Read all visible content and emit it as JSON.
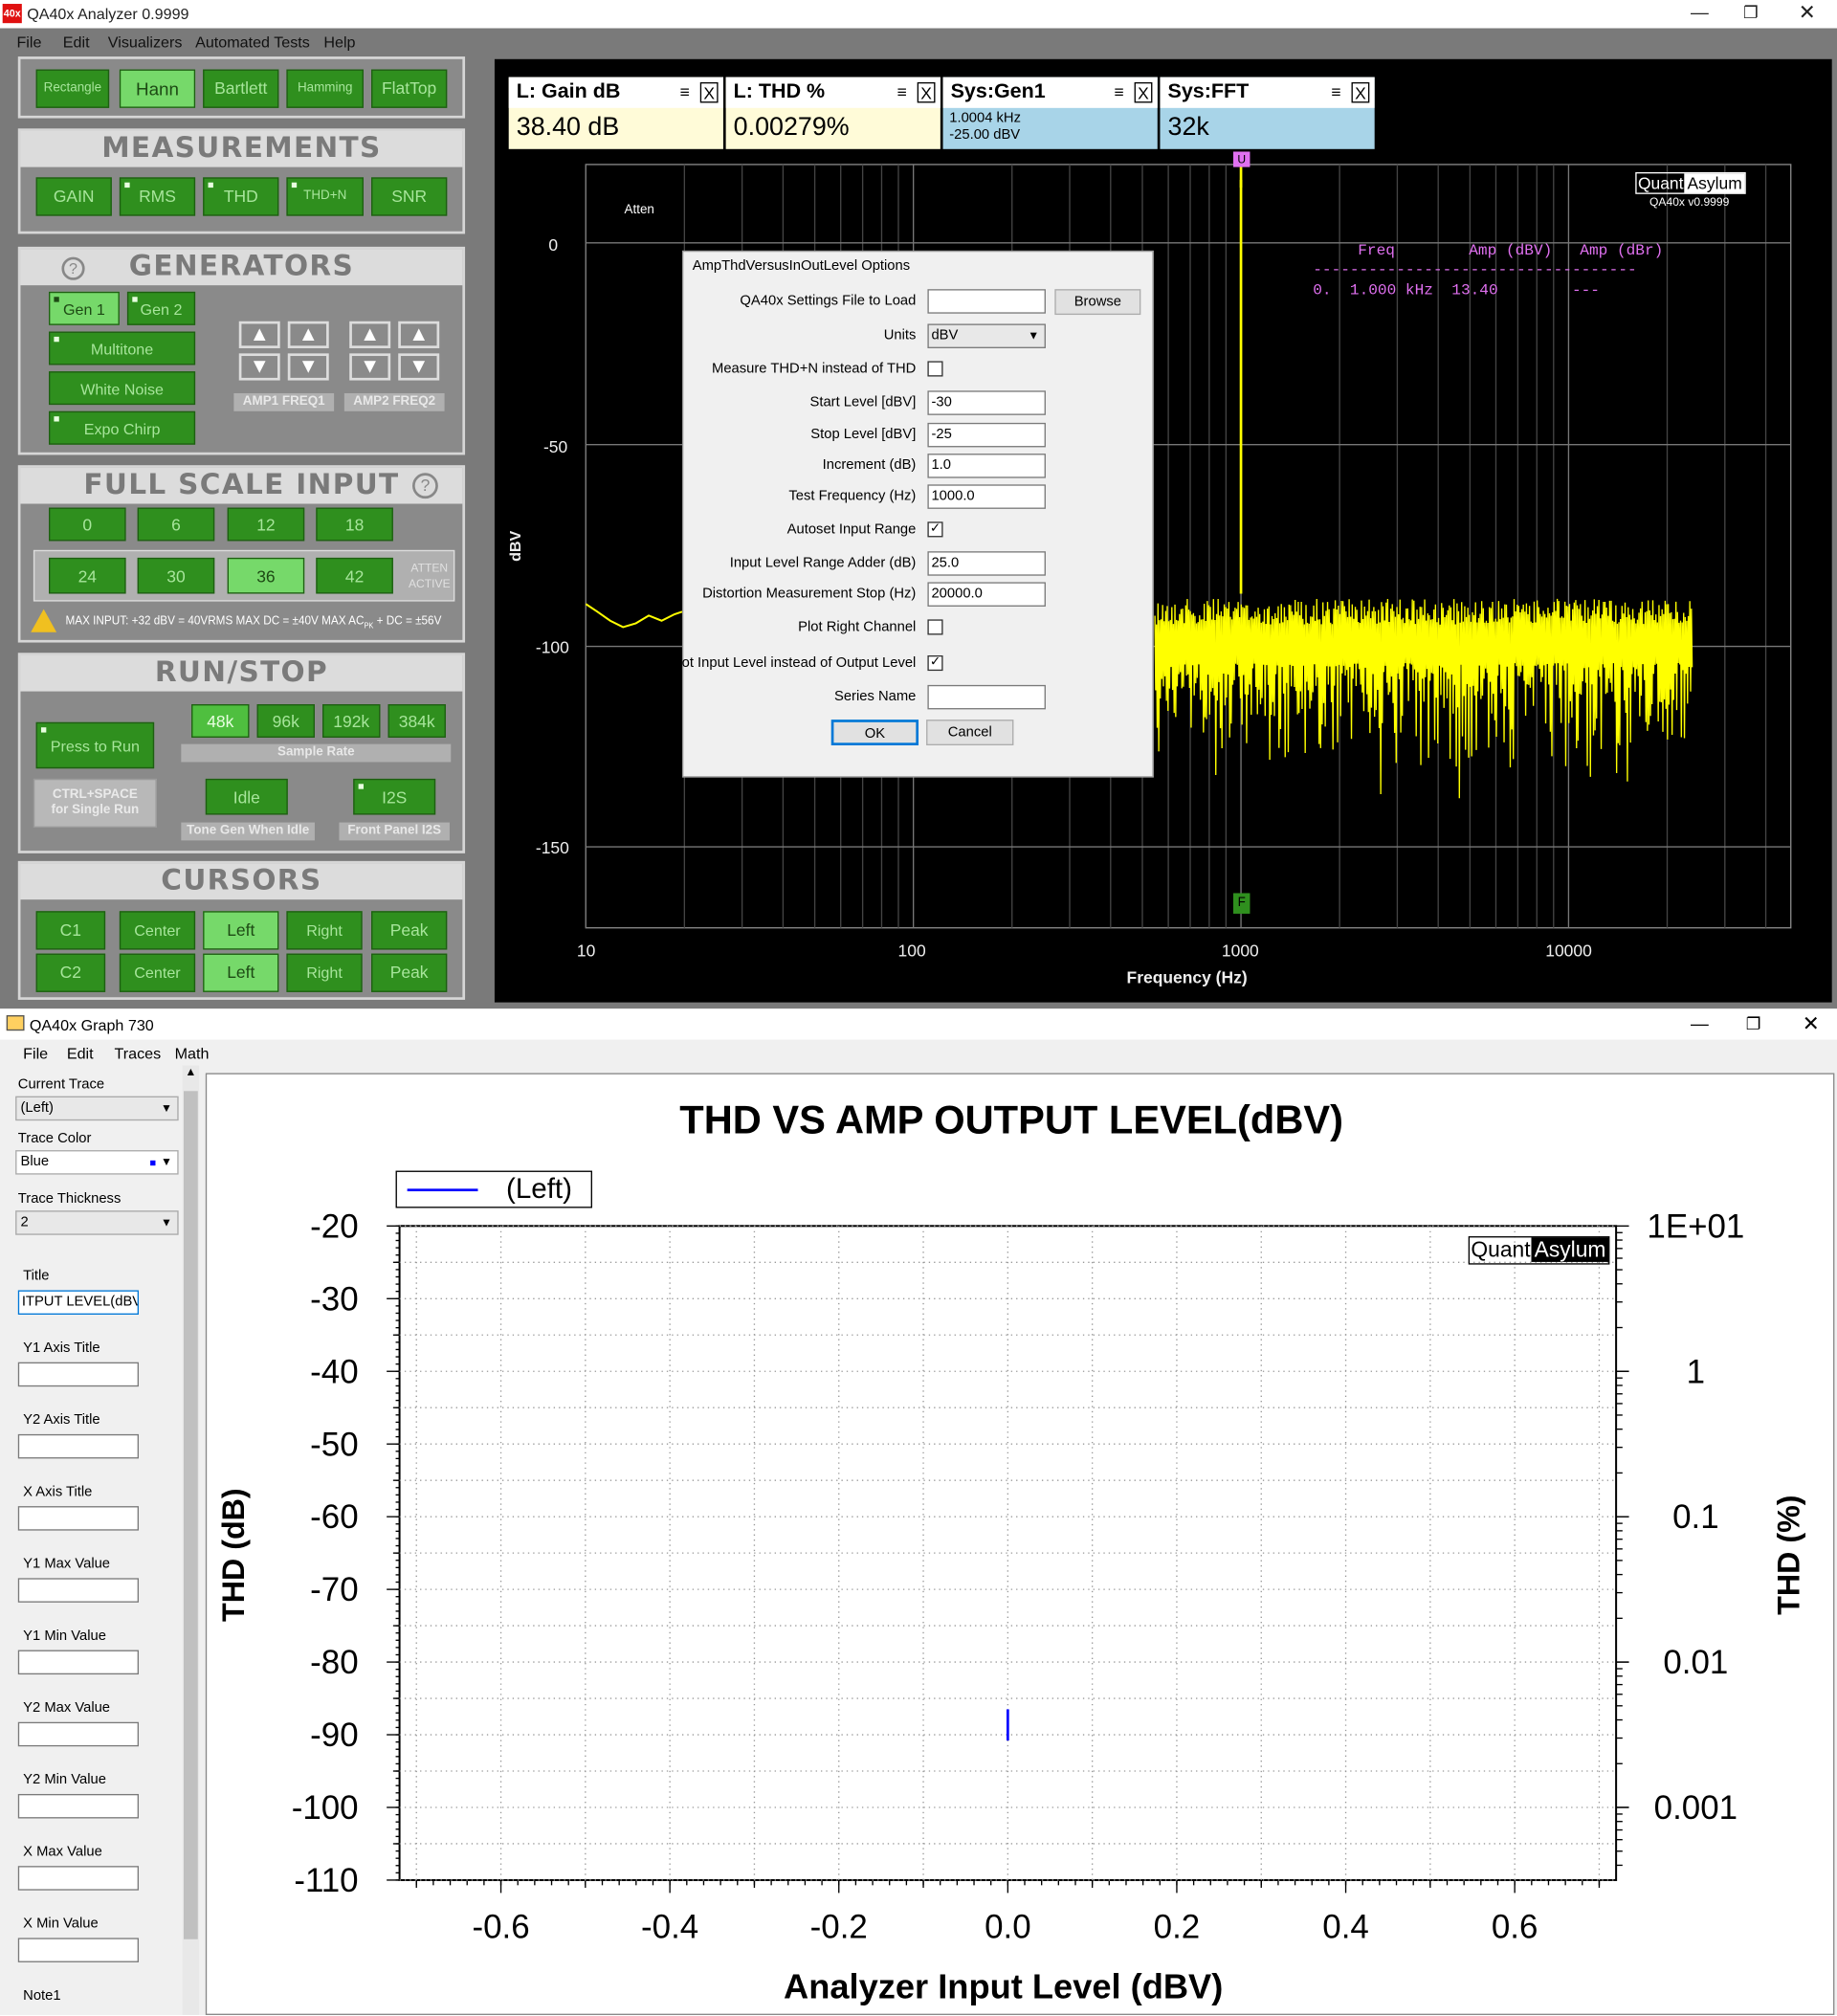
{
  "analyzer": {
    "title": "QA40x Analyzer 0.9999",
    "menu": [
      "File",
      "Edit",
      "Visualizers",
      "Automated Tests",
      "Help"
    ],
    "windows": [
      "Rectangle",
      "Hann",
      "Bartlett",
      "Hamming",
      "FlatTop"
    ],
    "measurements_title": "MEASUREMENTS",
    "measurements": [
      "GAIN",
      "RMS",
      "THD",
      "THD+N",
      "SNR"
    ],
    "generators_title": "GENERATORS",
    "gen_tabs": [
      "Gen 1",
      "Gen 2"
    ],
    "gen_types": [
      "Multitone",
      "White Noise",
      "Expo Chirp"
    ],
    "amp_label": "AMP1",
    "freq_label": "FREQ1",
    "amp2_label": "AMP2",
    "freq2_label": "FREQ2",
    "fsi_title": "FULL SCALE INPUT",
    "fsi_row1": [
      "0",
      "6",
      "12",
      "18"
    ],
    "fsi_row2": [
      "24",
      "30",
      "36",
      "42"
    ],
    "atten": "ATTEN",
    "active": "ACTIVE",
    "max_input": "MAX INPUT: +32 dBV = 40VRMS   MAX DC = ±40V   MAX AC",
    "max_input_sub": "PK",
    "max_input_end": " + DC = ±56V",
    "runstop_title": "RUN/STOP",
    "press_to_run": "Press to Run",
    "rates": [
      "48k",
      "96k",
      "192k",
      "384k"
    ],
    "sample_rate": "Sample Rate",
    "ctrl_space": "CTRL+SPACE",
    "single_run": "for Single Run",
    "idle": "Idle",
    "i2s": "I2S",
    "tone_gen_idle": "Tone Gen When Idle",
    "front_panel_i2s": "Front Panel I2S",
    "cursors_title": "CURSORS",
    "cursor_row1": [
      "C1",
      "Center",
      "Left",
      "Right",
      "Peak"
    ],
    "cursor_row2": [
      "C2",
      "Center",
      "Left",
      "Right",
      "Peak"
    ],
    "meas_boxes": [
      {
        "head": "L: Gain dB",
        "value": "38.40 dB"
      },
      {
        "head": "L: THD %",
        "value": "0.00279%"
      },
      {
        "head": "Sys:Gen1",
        "value1": "1.0004 kHz",
        "value2": "-25.00 dBV"
      },
      {
        "head": "Sys:FFT",
        "value": "32k"
      }
    ],
    "fft_ylabel": "dBV",
    "fft_xlabel": "Frequency (Hz)",
    "fft_yticks": [
      "0",
      "-50",
      "-100",
      "-150"
    ],
    "fft_xticks": [
      "10",
      "100",
      "1000",
      "10000"
    ],
    "atten_label": "Atten",
    "brand1": "Quant",
    "brand2": "Asylum",
    "version": "QA40x v0.9999",
    "table_head": "Freq        Amp (dBV)   Amp (dBr)",
    "table_dash": "-----------------------------------",
    "table_row": "0.  1.000 kHz  13.40        ---",
    "marker_u": "U",
    "marker_f": "F",
    "colors": {
      "trace": "#ffff00",
      "panel_green": "#2f8f1e",
      "light_green": "#76d96a",
      "table_text": "#e070f0"
    }
  },
  "dialog": {
    "title": "AmpThdVersusInOutLevel Options",
    "fields": [
      {
        "label": "QA40x Settings File to Load",
        "value": ""
      },
      {
        "label": "Units",
        "value": "dBV"
      },
      {
        "label": "Measure THD+N instead of THD",
        "checked": ""
      },
      {
        "label": "Start Level [dBV]",
        "value": "-30"
      },
      {
        "label": "Stop Level [dBV]",
        "value": "-25"
      },
      {
        "label": "Increment (dB)",
        "value": "1.0"
      },
      {
        "label": "Test Frequency (Hz)",
        "value": "1000.0"
      },
      {
        "label": "Autoset Input Range",
        "checked": "✓"
      },
      {
        "label": "Input Level Range Adder (dB)",
        "value": "25.0"
      },
      {
        "label": "Distortion Measurement Stop (Hz)",
        "value": "20000.0"
      },
      {
        "label": "Plot Right Channel",
        "checked": ""
      },
      {
        "label": "Plot Input Level instead of Output Level",
        "checked": "✓"
      },
      {
        "label": "Series Name",
        "value": ""
      }
    ],
    "browse": "Browse",
    "ok": "OK",
    "cancel": "Cancel"
  },
  "graph_window": {
    "title": "QA40x Graph 730",
    "menu": [
      "File",
      "Edit",
      "Traces",
      "Math"
    ],
    "current_trace_label": "Current Trace",
    "current_trace": "(Left)",
    "trace_color_label": "Trace Color",
    "trace_color": "Blue",
    "trace_thickness_label": "Trace Thickness",
    "trace_thickness": "2",
    "title_label": "Title",
    "title_value": "ITPUT LEVEL(dBV)",
    "y1_axis_title": "Y1 Axis Title",
    "y2_axis_title": "Y2 Axis Title",
    "x_axis_title": "X Axis Title",
    "y1_max": "Y1 Max Value",
    "y1_min": "Y1 Min Value",
    "y2_max": "Y2 Max Value",
    "y2_min": "Y2 Min Value",
    "x_max": "X Max Value",
    "x_min": "X Min Value",
    "note1": "Note1"
  },
  "chart_data": {
    "type": "line",
    "title": "THD VS AMP OUTPUT LEVEL(dBV)",
    "xlabel": "Analyzer Input Level (dBV)",
    "ylabel": "THD (dB)",
    "y2label": "THD (%)",
    "xlim": [
      -0.72,
      0.72
    ],
    "ylim": [
      -110,
      -20
    ],
    "xticks": [
      "-0.6",
      "-0.4",
      "-0.2",
      "0.0",
      "0.2",
      "0.4",
      "0.6"
    ],
    "yticks": [
      "-20",
      "-30",
      "-40",
      "-50",
      "-60",
      "-70",
      "-80",
      "-90",
      "-100",
      "-110"
    ],
    "y2ticks": [
      "1E+01",
      "1",
      "0.1",
      "0.01",
      "0.001"
    ],
    "legend": "(Left)",
    "grid": true,
    "series": [
      {
        "name": "(Left)",
        "color": "#0000ff",
        "x": [
          0.0,
          0.0
        ],
        "y": [
          -86.5,
          -90.8
        ]
      }
    ]
  }
}
